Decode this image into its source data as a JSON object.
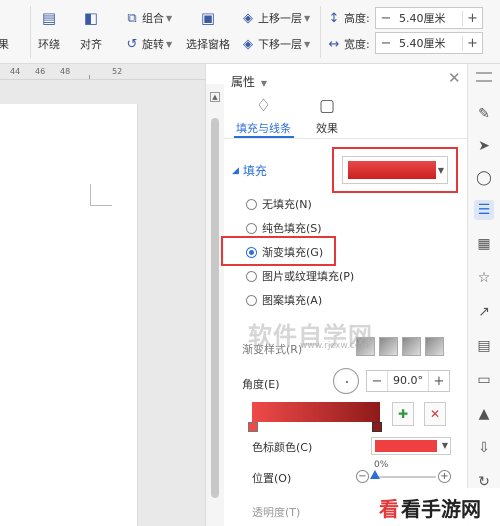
{
  "toolbar": {
    "arrange_label": "环绕",
    "align_label": "对齐",
    "group_label": "组合",
    "rotate_label": "旋转",
    "selection_pane_label": "选择窗格",
    "bring_forward_label": "上移一层",
    "send_backward_label": "下移一层",
    "height_label": "高度:",
    "height_value": "5.40厘米",
    "width_label": "宽度:",
    "width_value": "5.40厘米",
    "cut_label": "果"
  },
  "ruler": {
    "marks": [
      "44",
      "46",
      "48",
      "52"
    ]
  },
  "panel": {
    "title": "属性",
    "tab_fill_line": "填充与线条",
    "tab_effects": "效果",
    "section_fill": "填充",
    "fill_options": [
      {
        "label": "无填充(N)",
        "checked": false
      },
      {
        "label": "纯色填充(S)",
        "checked": false
      },
      {
        "label": "渐变填充(G)",
        "checked": true
      },
      {
        "label": "图片或纹理填充(P)",
        "checked": false
      },
      {
        "label": "图案填充(A)",
        "checked": false
      }
    ],
    "gradient_style_label": "渐变样式(R)",
    "angle_label": "角度(E)",
    "angle_value": "90.0°",
    "stop_color_label": "色标颜色(C)",
    "position_label": "位置(O)",
    "position_value": "0%",
    "opacity_label": "透明度(T)"
  },
  "watermark": {
    "text": "软件自学网",
    "sub": "www.rjzxw.com"
  },
  "logo": {
    "red": "看",
    "rest": "看手游网"
  },
  "colors": {
    "accent": "#2b6fd6",
    "fill_red": "#e03a3a",
    "gradient_end": "#8f1a1a"
  }
}
